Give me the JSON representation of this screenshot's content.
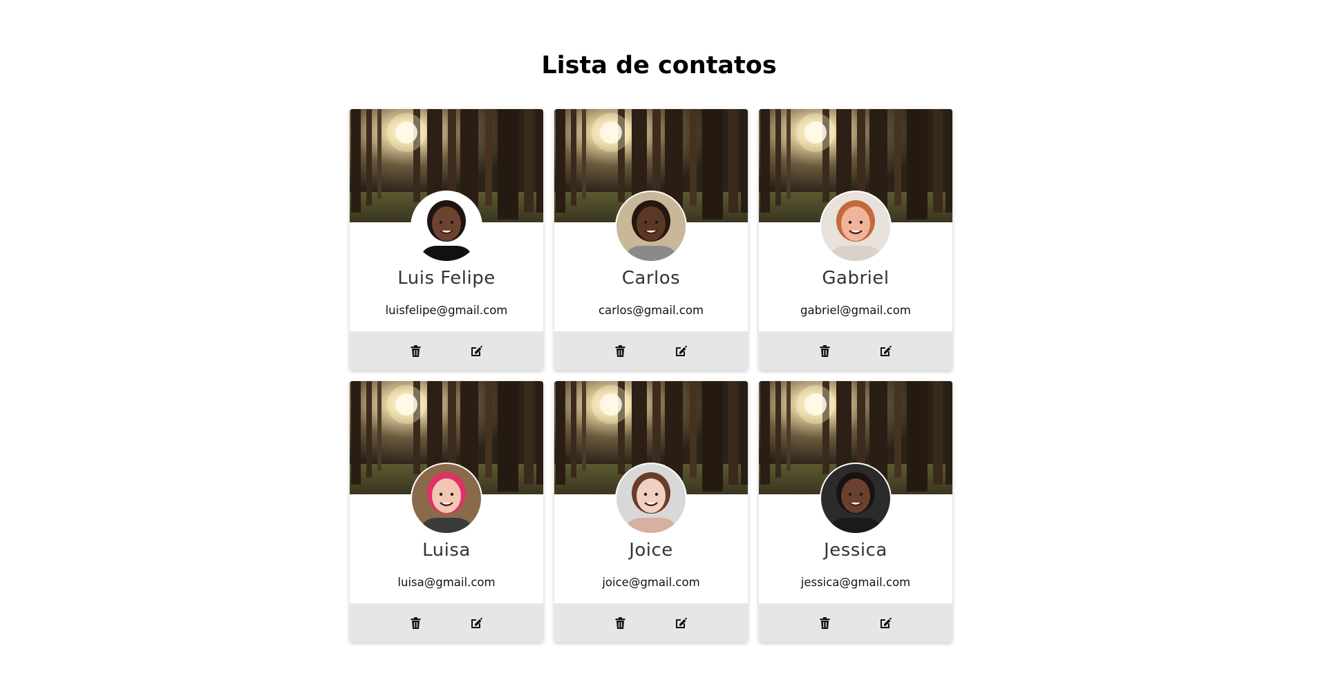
{
  "page": {
    "title": "Lista de contatos"
  },
  "theme": {
    "background": "#ffffff",
    "card_footer": "#e6e6e6",
    "name_color": "#333333",
    "icon_color": "#111111"
  },
  "contacts": [
    {
      "name": "Luis Felipe",
      "email": "luisfelipe@gmail.com",
      "avatar": {
        "skin": "#6b4330",
        "hair": "#1e1410",
        "shirt": "#111111",
        "bg": "#ffffff"
      }
    },
    {
      "name": "Carlos",
      "email": "carlos@gmail.com",
      "avatar": {
        "skin": "#5a3824",
        "hair": "#241710",
        "shirt": "#8a8a8a",
        "bg": "#c9b79a"
      }
    },
    {
      "name": "Gabriel",
      "email": "gabriel@gmail.com",
      "avatar": {
        "skin": "#f0b49a",
        "hair": "#c46a3a",
        "shirt": "#d9d2c9",
        "bg": "#e8e2da"
      }
    },
    {
      "name": "Luisa",
      "email": "luisa@gmail.com",
      "avatar": {
        "skin": "#f2c7b2",
        "hair": "#e0306a",
        "shirt": "#3a3a3a",
        "bg": "#8a6a4a"
      }
    },
    {
      "name": "Joice",
      "email": "joice@gmail.com",
      "avatar": {
        "skin": "#f0d0c0",
        "hair": "#6a3a2a",
        "shirt": "#d8b0a0",
        "bg": "#d8d8d8"
      }
    },
    {
      "name": "Jessica",
      "email": "jessica@gmail.com",
      "avatar": {
        "skin": "#6a4030",
        "hair": "#1a1212",
        "shirt": "#1a1a1a",
        "bg": "#2b2b2b"
      }
    }
  ],
  "icons": {
    "delete": "trash-icon",
    "edit": "edit-icon"
  }
}
